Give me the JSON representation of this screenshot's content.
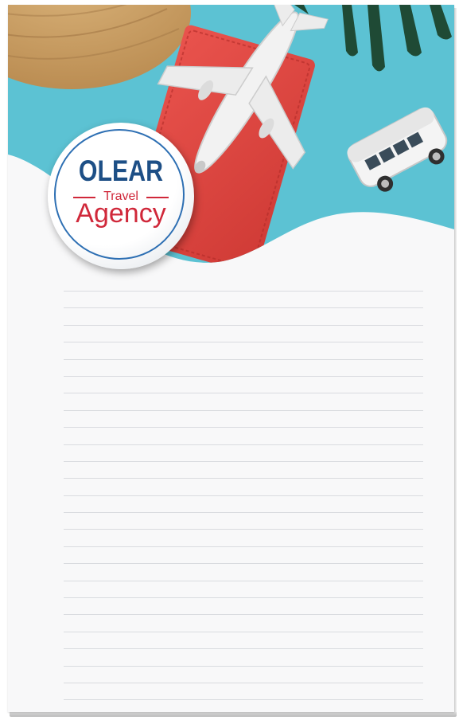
{
  "logo": {
    "name": "OLEAR",
    "travel": "Travel",
    "agency": "Agency",
    "name_color": "#1d4f86",
    "accent_color": "#d0283a"
  },
  "photo": {
    "background_color": "#5cc2d3",
    "subjects": [
      "straw-hat",
      "red-passport",
      "toy-airplane",
      "toy-van",
      "palm-leaves"
    ]
  },
  "notepad": {
    "ruled_line_count": 25,
    "paper_color": "#f8f8f9",
    "line_color": "#d9dbdf"
  }
}
